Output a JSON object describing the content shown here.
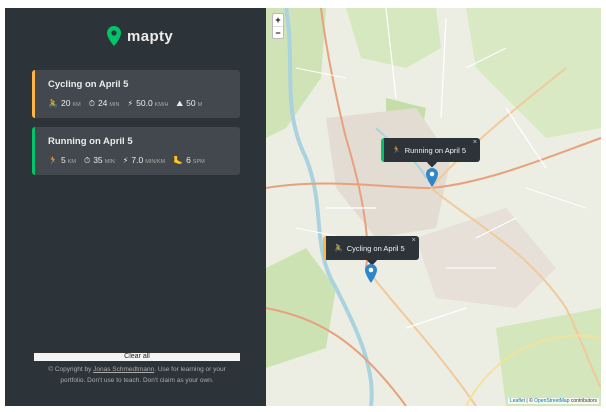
{
  "logo": {
    "text": "mapty",
    "icon": "map-pin-icon",
    "color": "#00c46a"
  },
  "workouts": [
    {
      "type": "cycling",
      "title": "Cycling on April 5",
      "accent": "#ffb545",
      "details": [
        {
          "icon": "🚴",
          "value": "20",
          "unit": "km"
        },
        {
          "icon": "⏱",
          "value": "24",
          "unit": "min"
        },
        {
          "icon": "⚡",
          "value": "50.0",
          "unit": "km/h"
        },
        {
          "icon": "⛰",
          "value": "50",
          "unit": "m"
        }
      ]
    },
    {
      "type": "running",
      "title": "Running on April 5",
      "accent": "#00c46a",
      "details": [
        {
          "icon": "🏃",
          "value": "5",
          "unit": "km"
        },
        {
          "icon": "⏱",
          "value": "35",
          "unit": "min"
        },
        {
          "icon": "⚡",
          "value": "7.0",
          "unit": "min/km"
        },
        {
          "icon": "🦶",
          "value": "6",
          "unit": "spm"
        }
      ]
    }
  ],
  "clear_button": "Clear all",
  "copyright": {
    "prefix": "© Copyright by ",
    "author": "Jonas Schmedtmann",
    "suffix": ". Use for learning or your portfolio. Don't use to teach. Don't claim as your own."
  },
  "map": {
    "zoom_in": "+",
    "zoom_out": "−",
    "popups": {
      "running": {
        "icon": "🏃",
        "label": "Running on April 5",
        "close": "×"
      },
      "cycling": {
        "icon": "🚴",
        "label": "Cycling on April 5",
        "close": "×"
      }
    },
    "attribution": {
      "leaflet": "Leaflet",
      "sep": " | © ",
      "osm": "OpenStreetMap",
      "contrib": " contributors"
    }
  }
}
